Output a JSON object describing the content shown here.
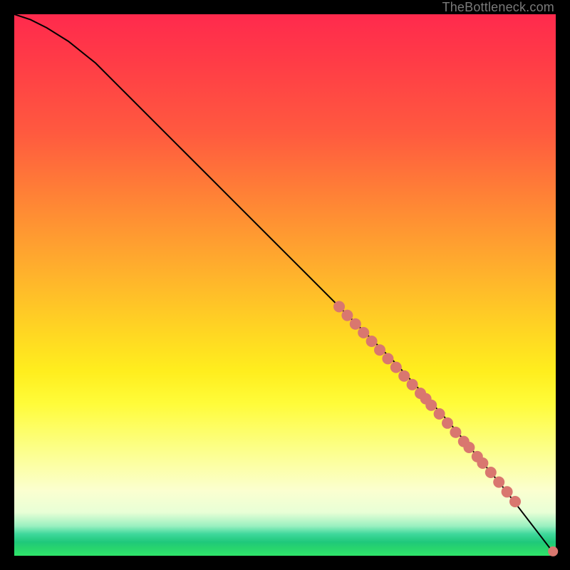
{
  "attribution": "TheBottleneck.com",
  "chart_data": {
    "type": "line",
    "title": "",
    "xlabel": "",
    "ylabel": "",
    "xlim": [
      0,
      100
    ],
    "ylim": [
      0,
      100
    ],
    "grid": false,
    "legend": false,
    "background_gradient": [
      {
        "stop": 0,
        "color": "#ff2a4d"
      },
      {
        "stop": 50,
        "color": "#ffc020"
      },
      {
        "stop": 75,
        "color": "#fffc3a"
      },
      {
        "stop": 95,
        "color": "#9af0c0"
      },
      {
        "stop": 100,
        "color": "#2fe56a"
      }
    ],
    "series": [
      {
        "name": "curve",
        "style": "line",
        "color": "#000000",
        "x": [
          0,
          3,
          6,
          10,
          15,
          20,
          30,
          40,
          50,
          60,
          70,
          80,
          90,
          100
        ],
        "y": [
          100,
          99,
          97.5,
          95,
          91,
          86,
          76,
          66,
          56,
          46,
          36,
          25,
          13,
          0
        ]
      },
      {
        "name": "points",
        "style": "scatter",
        "color": "#d9776f",
        "x": [
          60,
          61.5,
          63,
          64.5,
          66,
          67.5,
          69,
          70.5,
          72,
          73.5,
          75,
          76,
          77,
          78.5,
          80,
          81.5,
          83,
          84,
          85.5,
          86.5,
          88,
          89.5,
          91,
          92.5,
          99.5
        ],
        "y": [
          46,
          44.4,
          42.8,
          41.2,
          39.6,
          38,
          36.4,
          34.8,
          33.2,
          31.6,
          30,
          29,
          27.8,
          26.2,
          24.5,
          22.8,
          21.1,
          20,
          18.3,
          17.1,
          15.4,
          13.6,
          11.8,
          10,
          0.8
        ]
      }
    ]
  }
}
